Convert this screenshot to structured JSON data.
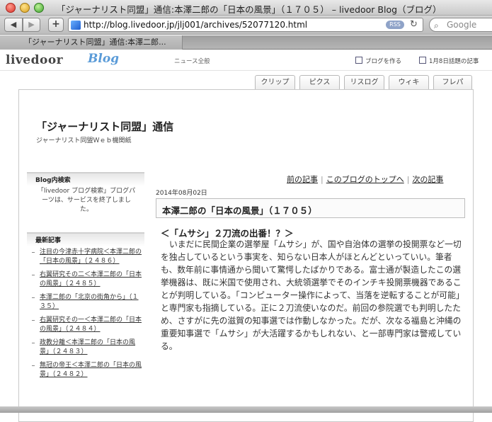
{
  "window": {
    "title": "「ジャーナリスト同盟」通信:本澤二郎の「日本の風景」（１７０５） – livedoor Blog（ブログ）"
  },
  "toolbar": {
    "url": "http://blog.livedoor.jp/jlj001/archives/52077120.html",
    "rss_label": "RSS",
    "search_placeholder": "Google"
  },
  "tab": {
    "label": "「ジャーナリスト同盟」通信:本澤二郎..."
  },
  "livedoor": {
    "logo": "livedoor",
    "blog": "Blog",
    "news_link": "ニュース全般",
    "make_blog": "ブログを作る",
    "trending": "1月8日話題の記事"
  },
  "global_nav": [
    "クリップ",
    "ピクス",
    "リスログ",
    "ウィキ",
    "フレパ"
  ],
  "blog": {
    "title": "「ジャーナリスト同盟」通信",
    "subtitle": "ジャーナリスト同盟Ｗｅｂ機関紙"
  },
  "sidebar": {
    "search_heading": "Blog内検索",
    "search_note": "「livedoor ブログ検索」ブログパーツは、サービスを終了しました。",
    "recent_heading": "最新記事",
    "recent_items": [
      "注目の今津赤十字病院＜本澤二郎の「日本の風景」（２４８６）",
      "右翼研究その二＜本澤二郎の「日本の風景」（２４８５）",
      "本澤二郎の「北京の街角から」（１３５）",
      "右翼研究その一＜本澤二郎の「日本の風景」（２４８４）",
      "政教分離＜本澤二郎の「日本の風景」（２４８３）",
      "無冠の帝王＜本澤二郎の「日本の風景」（２４８２）"
    ]
  },
  "post_nav": {
    "prev": "前の記事",
    "top": "このブログのトップへ",
    "next": "次の記事"
  },
  "post": {
    "date": "2014年08月02日",
    "title": "本澤二郎の「日本の風景」（１７０５）",
    "heading": "＜「ムサシ」２刀流の出番！？＞",
    "body": "いまだに民間企業の選挙屋「ムサシ」が、国や自治体の選挙の投開票など一切を独占しているという事実を、知らない日本人がほとんどといっていい。筆者も、数年前に事情通から聞いて驚愕したばかりである。富士通が製造したこの選挙機器は、既に米国で使用され、大統領選挙でそのインチキ投開票機器であることが判明している。「コンピューター操作によって、当落を逆転することが可能」と専門家も指摘している。正に２刀流使いなのだ。前回の参院選でも判明したため、さすがに先の滋賀の知事選では作動しなかった。だが、次なる福島と沖縄の重要知事選で「ムサシ」が大活躍するかもしれない、と一部専門家は警戒している。"
  }
}
